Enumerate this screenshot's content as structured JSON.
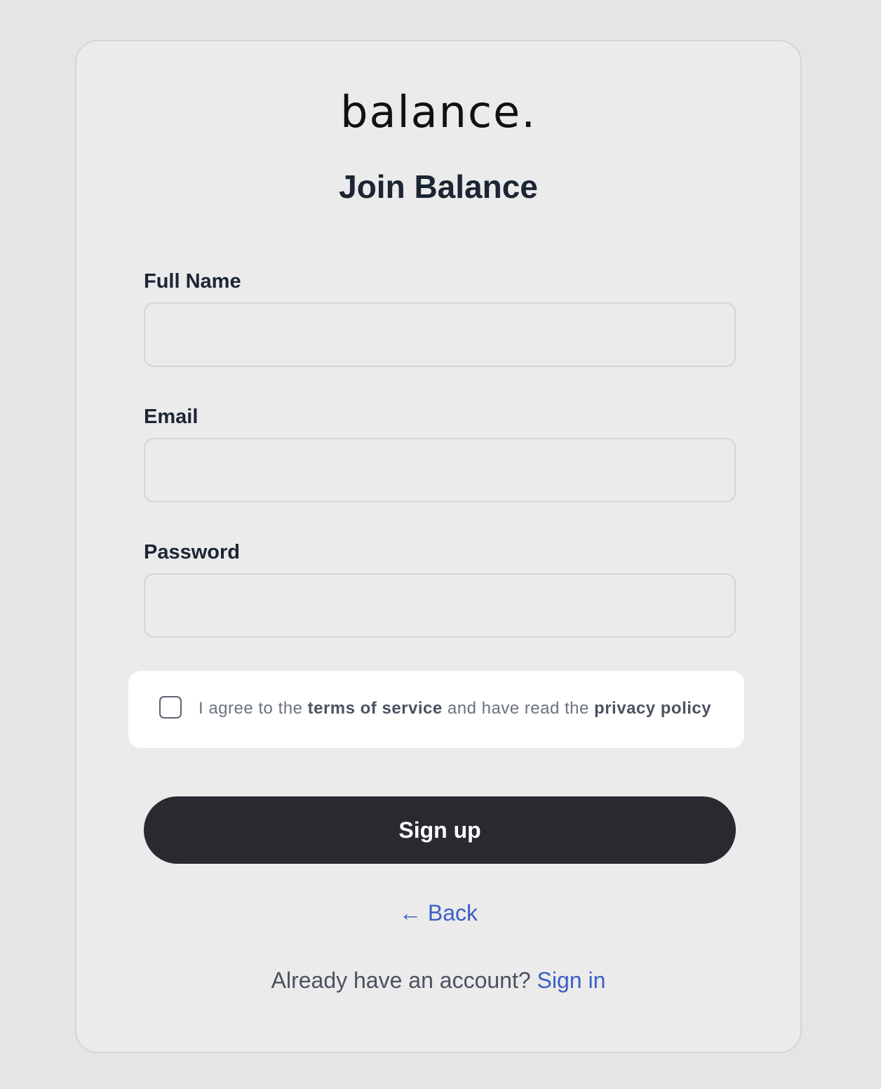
{
  "brand": {
    "logo_text": "balance."
  },
  "header": {
    "title": "Join Balance"
  },
  "form": {
    "full_name": {
      "label": "Full Name",
      "value": "",
      "placeholder": ""
    },
    "email": {
      "label": "Email",
      "value": "",
      "placeholder": ""
    },
    "password": {
      "label": "Password",
      "value": "",
      "placeholder": ""
    }
  },
  "agreement": {
    "checked": false,
    "prefix": "I agree to the ",
    "terms_link": "terms of service",
    "middle": " and have read the ",
    "privacy_link": "privacy policy"
  },
  "actions": {
    "signup_label": "Sign up",
    "back_arrow": "←",
    "back_label": "Back"
  },
  "footer": {
    "prompt": "Already have an account? ",
    "signin_label": "Sign in"
  },
  "colors": {
    "page_bg": "#e4e5e7",
    "card_bg": "#ebebeb",
    "primary_button": "#282a2f",
    "link": "#3b5fc7",
    "heading_text": "#1c2533"
  }
}
